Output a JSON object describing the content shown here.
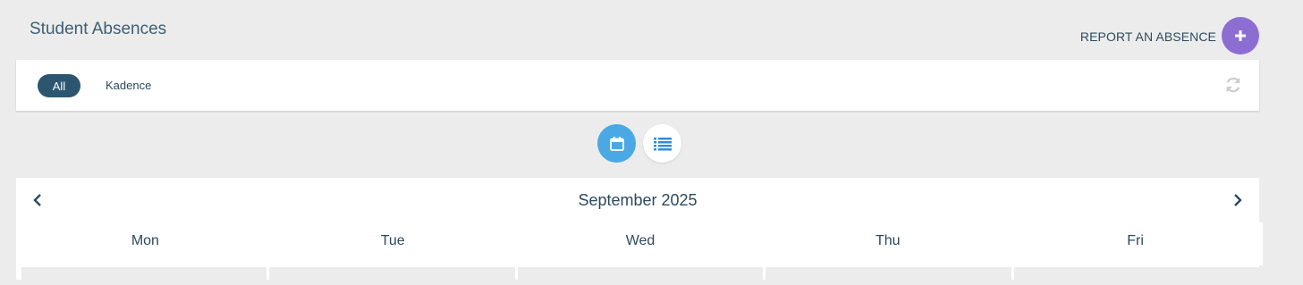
{
  "page_title": "Student Absences",
  "report": {
    "label": "REPORT AN ABSENCE",
    "icon": "plus-icon"
  },
  "filters": {
    "all_label": "All",
    "student_label": "Kadence",
    "refresh_icon": "refresh-icon"
  },
  "view_toggle": {
    "calendar_icon": "calendar-icon",
    "list_icon": "list-icon",
    "active": "calendar"
  },
  "calendar": {
    "month": "September 2025",
    "prev_icon": "chevron-left-icon",
    "next_icon": "chevron-right-icon",
    "weekdays": [
      "Mon",
      "Tue",
      "Wed",
      "Thu",
      "Fri"
    ]
  },
  "colors": {
    "accent_purple": "#8c6ed3",
    "accent_blue": "#4aa9e4",
    "navy": "#2c5570"
  }
}
